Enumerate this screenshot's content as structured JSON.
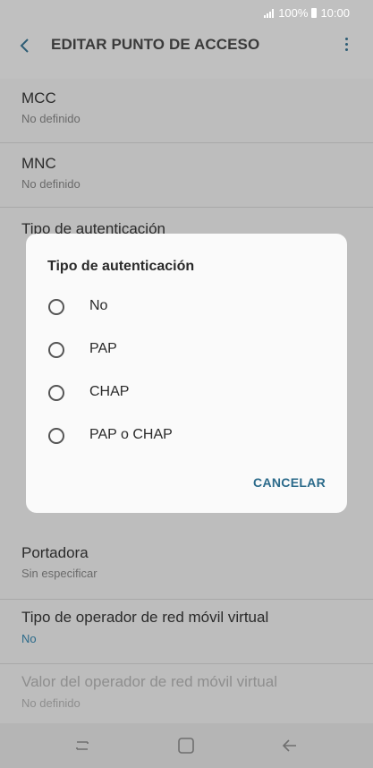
{
  "status_bar": {
    "battery": "100%",
    "time": "10:00"
  },
  "header": {
    "title": "EDITAR PUNTO DE ACCESO"
  },
  "settings": [
    {
      "label": "MCC",
      "value": "No definido"
    },
    {
      "label": "MNC",
      "value": "No definido"
    },
    {
      "label": "Tipo de autenticación",
      "value": ""
    },
    {
      "label": "Portadora",
      "value": "Sin especificar"
    },
    {
      "label": "Tipo de operador de red móvil virtual",
      "value": "No"
    },
    {
      "label": "Valor del operador de red móvil virtual",
      "value": "No definido"
    }
  ],
  "dialog": {
    "title": "Tipo de autenticación",
    "options": [
      "No",
      "PAP",
      "CHAP",
      "PAP o CHAP"
    ],
    "cancel_label": "CANCELAR"
  },
  "colors": {
    "accent": "#2b6a8a",
    "dialog_bg": "#fafafa",
    "scrim_bg": "#bdbdbd"
  },
  "icons": [
    "back-arrow-icon",
    "more-vert-icon",
    "recents-icon",
    "home-icon",
    "back-nav-icon"
  ]
}
